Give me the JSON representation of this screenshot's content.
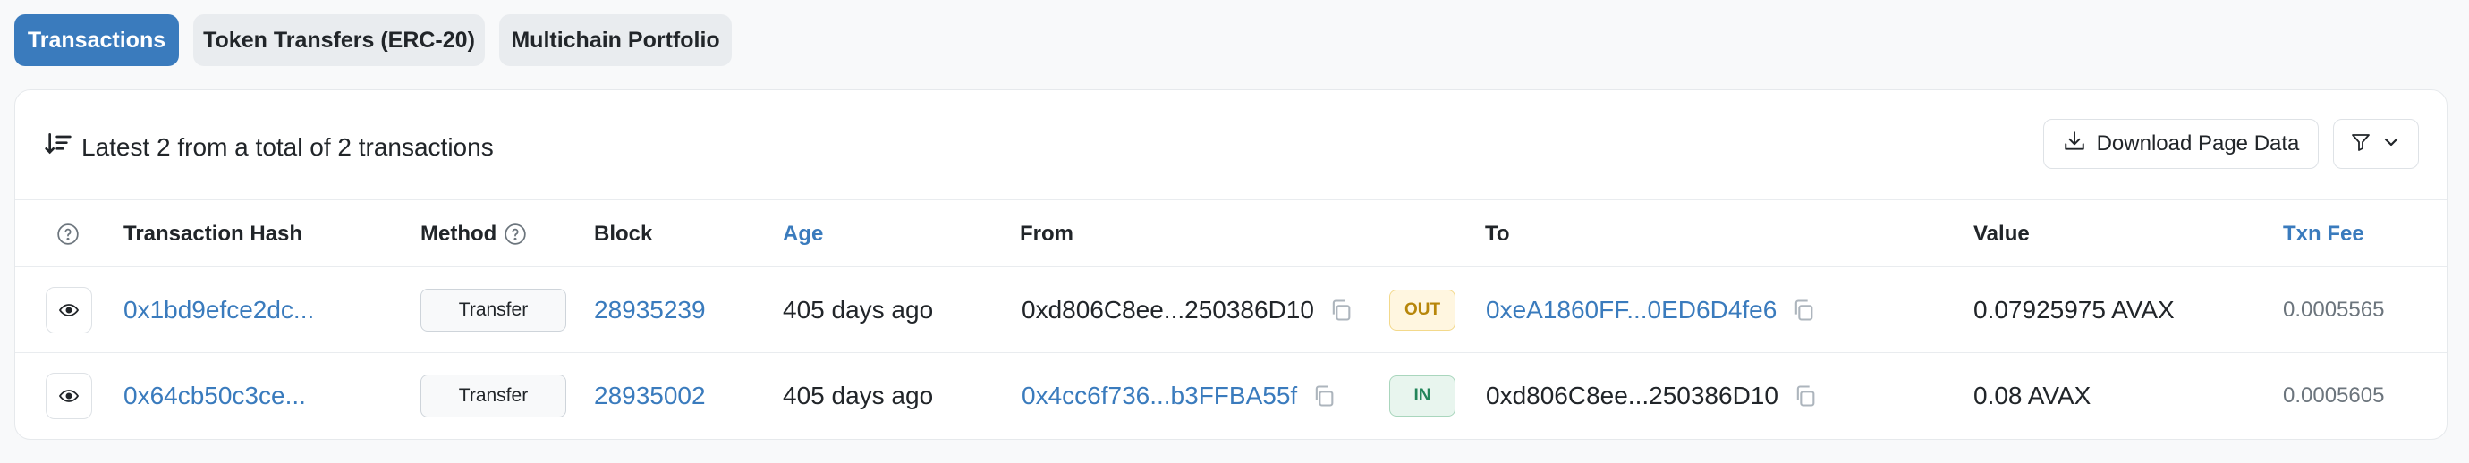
{
  "tabs": [
    {
      "label": "Transactions",
      "active": true
    },
    {
      "label": "Token Transfers (ERC-20)",
      "active": false
    },
    {
      "label": "Multichain Portfolio",
      "active": false
    }
  ],
  "summary": {
    "text": "Latest 2 from a total of 2 transactions"
  },
  "toolbar": {
    "download_label": "Download Page Data"
  },
  "columns": {
    "hash": "Transaction Hash",
    "method": "Method",
    "block": "Block",
    "age": "Age",
    "from": "From",
    "to": "To",
    "value": "Value",
    "fee": "Txn Fee"
  },
  "rows": [
    {
      "hash": "0x1bd9efce2dc...",
      "method": "Transfer",
      "block": "28935239",
      "age": "405 days ago",
      "from": "0xd806C8ee...250386D10",
      "direction": "OUT",
      "to": "0xeA1860FF...0ED6D4fe6",
      "value": "0.07925975 AVAX",
      "fee": "0.0005565"
    },
    {
      "hash": "0x64cb50c3ce...",
      "method": "Transfer",
      "block": "28935002",
      "age": "405 days ago",
      "from": "0x4cc6f736...b3FFBA55f",
      "direction": "IN",
      "to": "0xd806C8ee...250386D10",
      "value": "0.08 AVAX",
      "fee": "0.0005605"
    }
  ],
  "colors": {
    "accent": "#3a7bbd",
    "out_badge": "#b7860b",
    "in_badge": "#23855a"
  },
  "icons": [
    "sort-desc-icon",
    "download-icon",
    "filter-icon",
    "chevron-down-icon",
    "question-circle-icon",
    "eye-icon",
    "copy-icon"
  ]
}
